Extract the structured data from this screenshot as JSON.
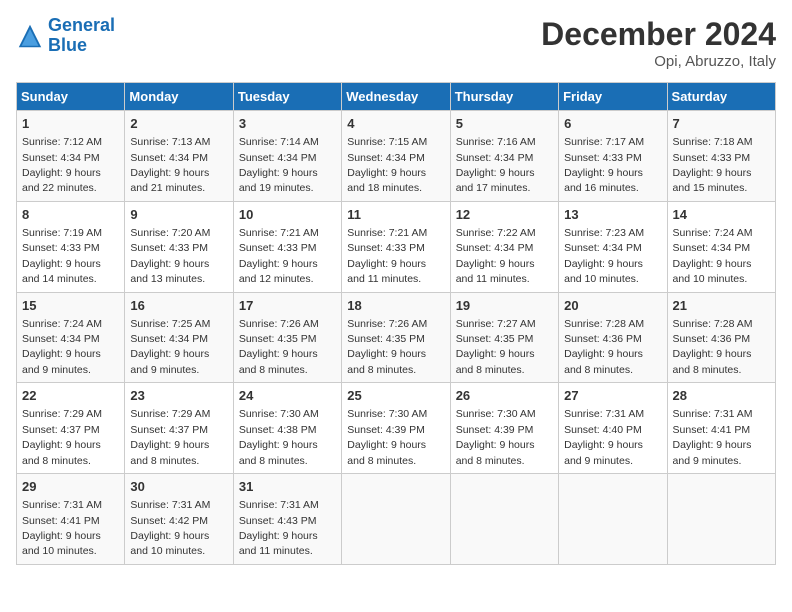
{
  "logo": {
    "line1": "General",
    "line2": "Blue"
  },
  "title": "December 2024",
  "subtitle": "Opi, Abruzzo, Italy",
  "weekdays": [
    "Sunday",
    "Monday",
    "Tuesday",
    "Wednesday",
    "Thursday",
    "Friday",
    "Saturday"
  ],
  "weeks": [
    [
      {
        "day": "1",
        "sunrise": "7:12 AM",
        "sunset": "4:34 PM",
        "daylight": "9 hours and 22 minutes."
      },
      {
        "day": "2",
        "sunrise": "7:13 AM",
        "sunset": "4:34 PM",
        "daylight": "9 hours and 21 minutes."
      },
      {
        "day": "3",
        "sunrise": "7:14 AM",
        "sunset": "4:34 PM",
        "daylight": "9 hours and 19 minutes."
      },
      {
        "day": "4",
        "sunrise": "7:15 AM",
        "sunset": "4:34 PM",
        "daylight": "9 hours and 18 minutes."
      },
      {
        "day": "5",
        "sunrise": "7:16 AM",
        "sunset": "4:34 PM",
        "daylight": "9 hours and 17 minutes."
      },
      {
        "day": "6",
        "sunrise": "7:17 AM",
        "sunset": "4:33 PM",
        "daylight": "9 hours and 16 minutes."
      },
      {
        "day": "7",
        "sunrise": "7:18 AM",
        "sunset": "4:33 PM",
        "daylight": "9 hours and 15 minutes."
      }
    ],
    [
      {
        "day": "8",
        "sunrise": "7:19 AM",
        "sunset": "4:33 PM",
        "daylight": "9 hours and 14 minutes."
      },
      {
        "day": "9",
        "sunrise": "7:20 AM",
        "sunset": "4:33 PM",
        "daylight": "9 hours and 13 minutes."
      },
      {
        "day": "10",
        "sunrise": "7:21 AM",
        "sunset": "4:33 PM",
        "daylight": "9 hours and 12 minutes."
      },
      {
        "day": "11",
        "sunrise": "7:21 AM",
        "sunset": "4:33 PM",
        "daylight": "9 hours and 11 minutes."
      },
      {
        "day": "12",
        "sunrise": "7:22 AM",
        "sunset": "4:34 PM",
        "daylight": "9 hours and 11 minutes."
      },
      {
        "day": "13",
        "sunrise": "7:23 AM",
        "sunset": "4:34 PM",
        "daylight": "9 hours and 10 minutes."
      },
      {
        "day": "14",
        "sunrise": "7:24 AM",
        "sunset": "4:34 PM",
        "daylight": "9 hours and 10 minutes."
      }
    ],
    [
      {
        "day": "15",
        "sunrise": "7:24 AM",
        "sunset": "4:34 PM",
        "daylight": "9 hours and 9 minutes."
      },
      {
        "day": "16",
        "sunrise": "7:25 AM",
        "sunset": "4:34 PM",
        "daylight": "9 hours and 9 minutes."
      },
      {
        "day": "17",
        "sunrise": "7:26 AM",
        "sunset": "4:35 PM",
        "daylight": "9 hours and 8 minutes."
      },
      {
        "day": "18",
        "sunrise": "7:26 AM",
        "sunset": "4:35 PM",
        "daylight": "9 hours and 8 minutes."
      },
      {
        "day": "19",
        "sunrise": "7:27 AM",
        "sunset": "4:35 PM",
        "daylight": "9 hours and 8 minutes."
      },
      {
        "day": "20",
        "sunrise": "7:28 AM",
        "sunset": "4:36 PM",
        "daylight": "9 hours and 8 minutes."
      },
      {
        "day": "21",
        "sunrise": "7:28 AM",
        "sunset": "4:36 PM",
        "daylight": "9 hours and 8 minutes."
      }
    ],
    [
      {
        "day": "22",
        "sunrise": "7:29 AM",
        "sunset": "4:37 PM",
        "daylight": "9 hours and 8 minutes."
      },
      {
        "day": "23",
        "sunrise": "7:29 AM",
        "sunset": "4:37 PM",
        "daylight": "9 hours and 8 minutes."
      },
      {
        "day": "24",
        "sunrise": "7:30 AM",
        "sunset": "4:38 PM",
        "daylight": "9 hours and 8 minutes."
      },
      {
        "day": "25",
        "sunrise": "7:30 AM",
        "sunset": "4:39 PM",
        "daylight": "9 hours and 8 minutes."
      },
      {
        "day": "26",
        "sunrise": "7:30 AM",
        "sunset": "4:39 PM",
        "daylight": "9 hours and 8 minutes."
      },
      {
        "day": "27",
        "sunrise": "7:31 AM",
        "sunset": "4:40 PM",
        "daylight": "9 hours and 9 minutes."
      },
      {
        "day": "28",
        "sunrise": "7:31 AM",
        "sunset": "4:41 PM",
        "daylight": "9 hours and 9 minutes."
      }
    ],
    [
      {
        "day": "29",
        "sunrise": "7:31 AM",
        "sunset": "4:41 PM",
        "daylight": "9 hours and 10 minutes."
      },
      {
        "day": "30",
        "sunrise": "7:31 AM",
        "sunset": "4:42 PM",
        "daylight": "9 hours and 10 minutes."
      },
      {
        "day": "31",
        "sunrise": "7:31 AM",
        "sunset": "4:43 PM",
        "daylight": "9 hours and 11 minutes."
      },
      null,
      null,
      null,
      null
    ]
  ]
}
